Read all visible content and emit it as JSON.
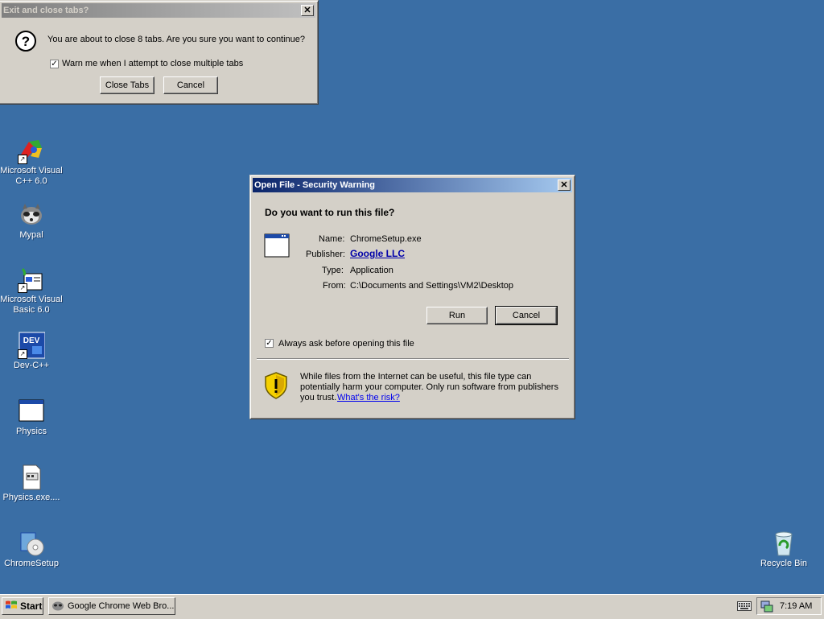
{
  "desktop_icons": [
    {
      "label": "Microsoft Visual C++ 6.0",
      "icon": "visual-cpp-icon"
    },
    {
      "label": "Mypal",
      "icon": "mypal-raccoon-icon"
    },
    {
      "label": "Microsoft Visual Basic 6.0",
      "icon": "visual-basic-icon"
    },
    {
      "label": "Dev-C++",
      "icon": "dev-cpp-icon"
    },
    {
      "label": "Physics",
      "icon": "window-app-icon"
    },
    {
      "label": "Physics.exe....",
      "icon": "exe-file-icon"
    },
    {
      "label": "ChromeSetup",
      "icon": "setup-installer-icon"
    },
    {
      "label": "Recycle Bin",
      "icon": "recycle-bin-icon"
    }
  ],
  "close_tabs_dialog": {
    "title": "Exit and close tabs?",
    "close_glyph": "✕",
    "message": "You are about to close 8 tabs. Are you sure you want to continue?",
    "checkbox_label": "Warn me when I attempt to close multiple tabs",
    "checkbox_checked": true,
    "primary_button": "Close Tabs",
    "cancel_button": "Cancel"
  },
  "security_dialog": {
    "title": "Open File - Security Warning",
    "close_glyph": "✕",
    "question": "Do you want to run this file?",
    "fields": [
      {
        "label": "Name:",
        "value": "ChromeSetup.exe"
      },
      {
        "label": "Publisher:",
        "value": "Google LLC"
      },
      {
        "label": "Type:",
        "value": "Application"
      },
      {
        "label": "From:",
        "value": "C:\\Documents and Settings\\VM2\\Desktop"
      }
    ],
    "run_button": "Run",
    "cancel_button": "Cancel",
    "checkbox_label": "Always ask before opening this file",
    "checkbox_checked": true,
    "warning_line1": "While files from the Internet can be useful, this file type can",
    "warning_line2": "potentially harm your computer. Only run software from publishers",
    "warning_line3": "you trust.",
    "risk_link": "What's the risk?"
  },
  "taskbar": {
    "start_label": "Start",
    "task_label": "Google Chrome Web Bro...",
    "clock": "7:19 AM"
  },
  "colors": {
    "desktop": "#3a6ea5",
    "title_active": "#0a246a",
    "chrome_face": "#d4d0c8"
  }
}
